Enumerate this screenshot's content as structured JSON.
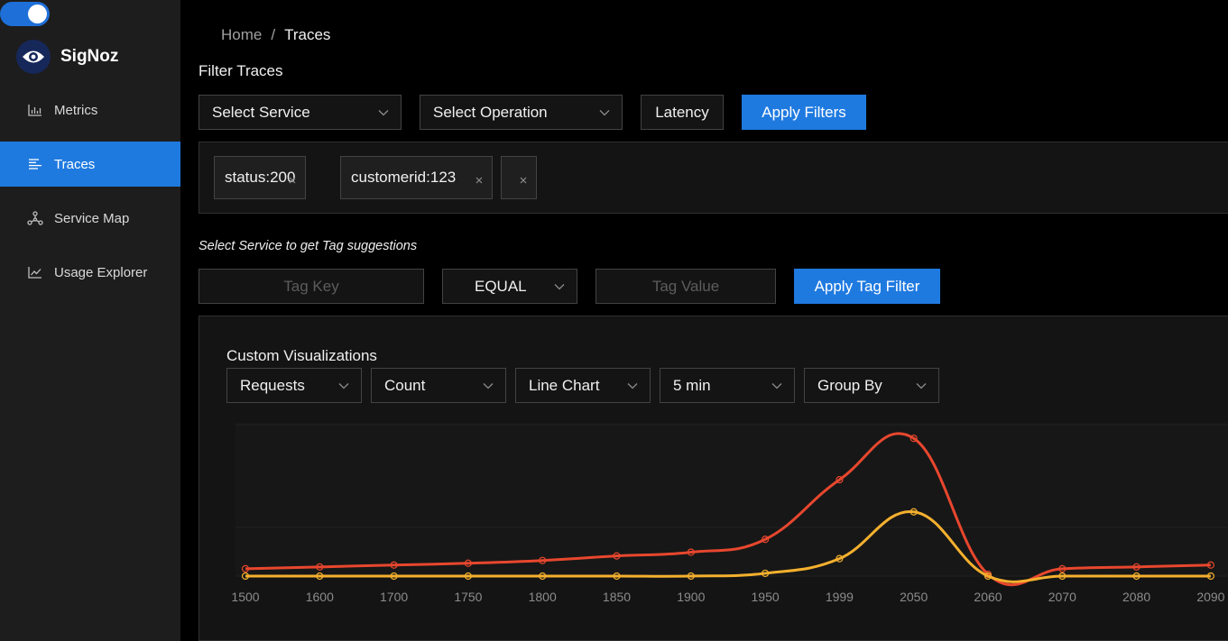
{
  "sidebar": {
    "brand": "SigNoz",
    "items": [
      {
        "label": "Metrics",
        "icon": "bar-chart-icon",
        "active": false
      },
      {
        "label": "Traces",
        "icon": "align-left-icon",
        "active": true
      },
      {
        "label": "Service Map",
        "icon": "deployment-unit-icon",
        "active": false
      },
      {
        "label": "Usage Explorer",
        "icon": "line-chart-icon",
        "active": false
      }
    ]
  },
  "breadcrumb": {
    "home": "Home",
    "separator": "/",
    "current": "Traces"
  },
  "filters": {
    "title": "Filter Traces",
    "service_select": "Select Service",
    "operation_select": "Select Operation",
    "latency_button": "Latency",
    "apply_button": "Apply Filters"
  },
  "tags": [
    {
      "label": "status:200"
    },
    {
      "label": "customerid:123"
    },
    {
      "label": ""
    }
  ],
  "tag_filter": {
    "hint": "Select Service to get Tag suggestions",
    "key_placeholder": "Tag Key",
    "operator": "EQUAL",
    "value_placeholder": "Tag Value",
    "apply_button": "Apply Tag Filter"
  },
  "visualization": {
    "title": "Custom Visualizations",
    "selects": [
      "Requests",
      "Count",
      "Line Chart",
      "5 min",
      "Group By"
    ]
  },
  "colors": {
    "accent": "#1f7ae0",
    "series_red": "#e8472e",
    "series_yellow": "#f4b02e"
  },
  "chart_data": {
    "type": "line",
    "x": [
      "1500",
      "1600",
      "1700",
      "1750",
      "1800",
      "1850",
      "1900",
      "1950",
      "1999",
      "2050",
      "2060",
      "2070",
      "2080",
      "2090"
    ],
    "series": [
      {
        "values": [
          8,
          10,
          12,
          14,
          17,
          22,
          26,
          40,
          105,
          150,
          2,
          8,
          10,
          12
        ]
      },
      {
        "values": [
          0,
          0,
          0,
          0,
          0,
          0,
          0,
          3,
          19,
          70,
          0,
          0,
          0,
          0
        ]
      }
    ],
    "ylim": [
      0,
      165
    ],
    "grid": true
  }
}
